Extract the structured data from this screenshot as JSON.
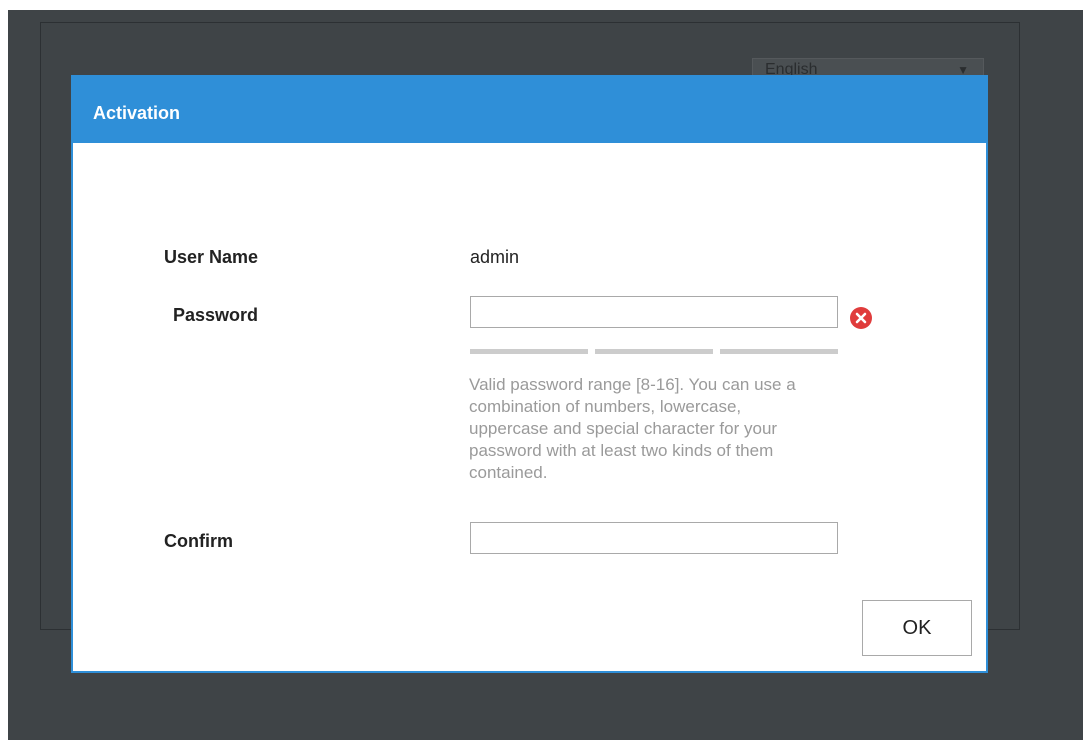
{
  "background": {
    "language_select_value": "English"
  },
  "dialog": {
    "title": "Activation",
    "fields": {
      "user_name_label": "User Name",
      "user_name_value": "admin",
      "password_label": "Password",
      "password_value": "",
      "confirm_label": "Confirm",
      "confirm_value": ""
    },
    "password_hint": "Valid password range [8-16]. You can use a combination of numbers, lowercase, uppercase and special character for your password with at least two kinds of them contained.",
    "ok_label": "OK",
    "icons": {
      "password_status": "error-x-icon"
    }
  },
  "colors": {
    "header_blue": "#2f8fd8",
    "overlay": "#3f4447",
    "error_red": "#e03c3c",
    "hint_gray": "#9a9a9a"
  }
}
